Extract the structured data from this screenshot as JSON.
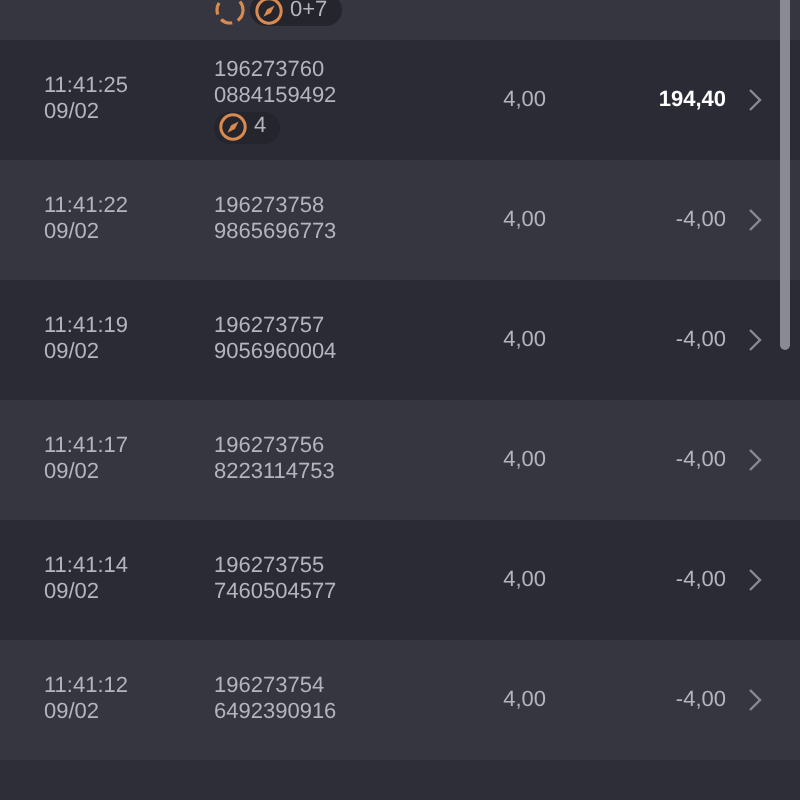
{
  "rows": [
    {
      "pending": true,
      "badge": "0+7"
    },
    {
      "time": "11:41:25",
      "date": "09/02",
      "id": "196273760",
      "code": "0884159492",
      "stake": "4,00",
      "result": "194,40",
      "won": true,
      "badge": "4"
    },
    {
      "time": "11:41:22",
      "date": "09/02",
      "id": "196273758",
      "code": "9865696773",
      "stake": "4,00",
      "result": "-4,00",
      "won": false
    },
    {
      "time": "11:41:19",
      "date": "09/02",
      "id": "196273757",
      "code": "9056960004",
      "stake": "4,00",
      "result": "-4,00",
      "won": false
    },
    {
      "time": "11:41:17",
      "date": "09/02",
      "id": "196273756",
      "code": "8223114753",
      "stake": "4,00",
      "result": "-4,00",
      "won": false
    },
    {
      "time": "11:41:14",
      "date": "09/02",
      "id": "196273755",
      "code": "7460504577",
      "stake": "4,00",
      "result": "-4,00",
      "won": false
    },
    {
      "time": "11:41:12",
      "date": "09/02",
      "id": "196273754",
      "code": "6492390916",
      "stake": "4,00",
      "result": "-4,00",
      "won": false
    }
  ]
}
